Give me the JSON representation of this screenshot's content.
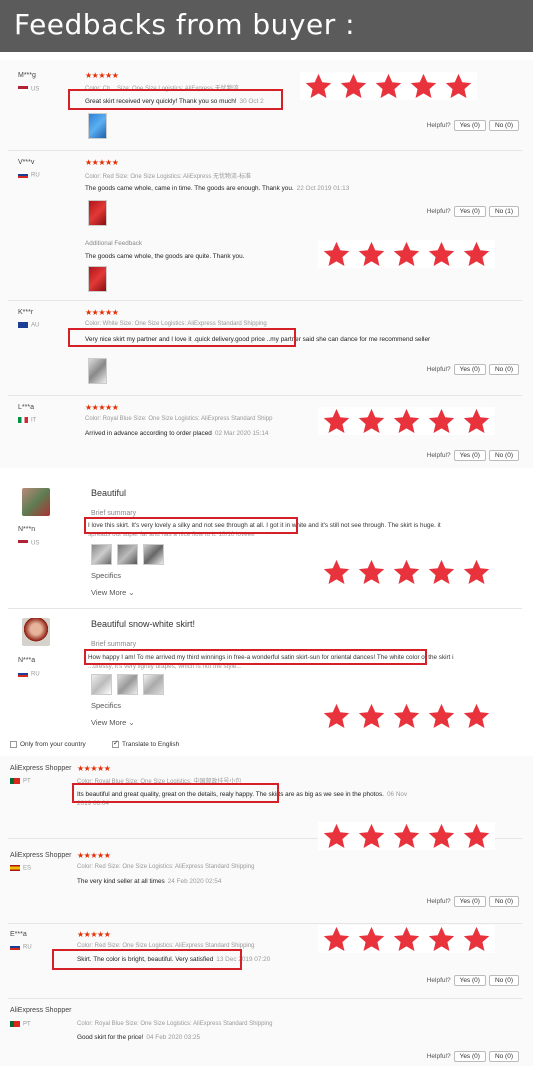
{
  "banner": {
    "title": "Feedbacks from buyer :"
  },
  "labels": {
    "helpful": "Helpful?",
    "additional": "Additional Feedback",
    "brief": "Brief summary",
    "specifics": "Specifics",
    "view_more": "View More",
    "only_country": "Only from your country",
    "translate": "Translate to English"
  },
  "rating_stars": "★★★★★",
  "reviews": [
    {
      "name": "M***g",
      "country": "US",
      "meta": "Color: Ch... Size: One Size  Logistics: AliExpress 无忧物流",
      "text": "Great skirt received very quickly! Thank you so much!",
      "date": "30 Oct 2",
      "yes": "Yes (0)",
      "no": "No (0)"
    },
    {
      "name": "V***v",
      "country": "RU",
      "meta": "Color: Red   Size: One Size   Logistics: AliExpress 无忧物流-标准",
      "text": "The goods came whole, came in time. The goods are enough. Thank you.",
      "date": "22 Oct 2019 01:13",
      "additional_text": "The goods came whole, the goods are quite. Thank you.",
      "yes": "Yes (0)",
      "no": "No (1)"
    },
    {
      "name": "K***r",
      "country": "AU",
      "meta": "Color: White   Size: One Size   Logistics: AliExpress Standard Shipping",
      "text": "Very nice skirt my partner and I love it .quick delivery.good price ..my partner said she can dance for me recommend seller",
      "yes": "Yes (0)",
      "no": "No (0)"
    },
    {
      "name": "L***a",
      "country": "IT",
      "meta": "Color: Royal Blue   Size: One Size   Logistics: AliExpress Standard Shipp",
      "text": "Arrived in advance according to order placed",
      "date": "02 Mar 2020 15:14",
      "yes": "Yes (0)",
      "no": "No (0)"
    }
  ],
  "reviews2": [
    {
      "name": "N***n",
      "country": "US",
      "title": "Beautiful",
      "text": "I love this skirt. It's very lovely a silky and not see through at all. I got it in white and it's still not see through. The skirt is huge. it",
      "text2": "spreads out super far and has a nice flow to it. 10/10 loveee"
    },
    {
      "name": "N***a",
      "country": "RU",
      "title": "Beautiful snow-white skirt!",
      "text": "How happy I am! To me arrived my third winnings in free-a wonderful satin skirt-sun for oriental dances! The white color of the skirt i",
      "text2": "...dressy, it's very lightly drapes, which is not the style..."
    }
  ],
  "reviews3": [
    {
      "name": "AliExpress Shopper",
      "country": "PT",
      "meta": "Color: Royal Blue   Size: One Size   Logistics: 中国邮政挂号小包",
      "text": "Its beautiful and great quality, great on the details, realy happy. The skirts are as big as we see in the photos.",
      "date": "06 Nov",
      "date2": "2019 06:04"
    },
    {
      "name": "AliExpress Shopper",
      "country": "ES",
      "meta": "Color: Red   Size: One Size   Logistics: AliExpress Standard Shipping",
      "text": "The very kind seller at all times",
      "date": "24 Feb 2020 02:54",
      "yes": "Yes (0)",
      "no": "No (0)"
    },
    {
      "name": "E***a",
      "country": "RU",
      "meta": "Color: Red   Size: One Size   Logistics: AliExpress Standard Shipping",
      "text": "Skirt. The color is bright, beautiful. Very satisfied",
      "date": "13 Dec 2019 07:20",
      "yes": "Yes (0)",
      "no": "No (0)"
    },
    {
      "name": "AliExpress Shopper",
      "country": "PT",
      "meta": "Color: Royal Blue   Size: One Size   Logistics: AliExpress Standard Shipping",
      "text": "Good skirt for the price!",
      "date": "04 Feb 2020 03:25",
      "yes": "Yes (0)",
      "no": "No (0)"
    }
  ],
  "colors": {
    "star": "#e8323c",
    "highlight": "#d62027",
    "banner": "#5b5b5b",
    "rating": "#e62e04"
  }
}
